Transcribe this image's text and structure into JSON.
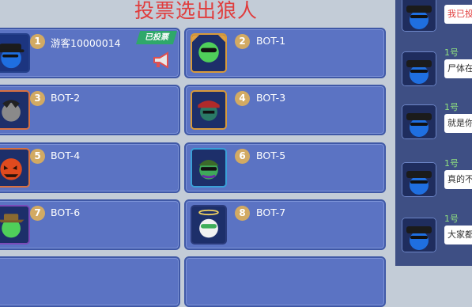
{
  "title": "投票选出狼人",
  "voted_label": "已投票",
  "players": [
    {
      "seat": "1",
      "name": "游客10000014"
    },
    {
      "seat": "2",
      "name": "BOT-1"
    },
    {
      "seat": "3",
      "name": "BOT-2"
    },
    {
      "seat": "4",
      "name": "BOT-3"
    },
    {
      "seat": "5",
      "name": "BOT-4"
    },
    {
      "seat": "6",
      "name": "BOT-5"
    },
    {
      "seat": "7",
      "name": "BOT-6"
    },
    {
      "seat": "8",
      "name": "BOT-7"
    }
  ],
  "chat": [
    {
      "seat": "",
      "text": "我已投"
    },
    {
      "seat": "1号",
      "text": "尸体在"
    },
    {
      "seat": "1号",
      "text": "就是你"
    },
    {
      "seat": "1号",
      "text": "真的不"
    },
    {
      "seat": "1号",
      "text": "大家都"
    }
  ],
  "colors": {
    "title": "#e03c3c",
    "card_bg": "#5b73c3",
    "badge": "#d2aa63",
    "voted_tag": "#2fa86a",
    "chat_seat": "#8fe07f"
  }
}
